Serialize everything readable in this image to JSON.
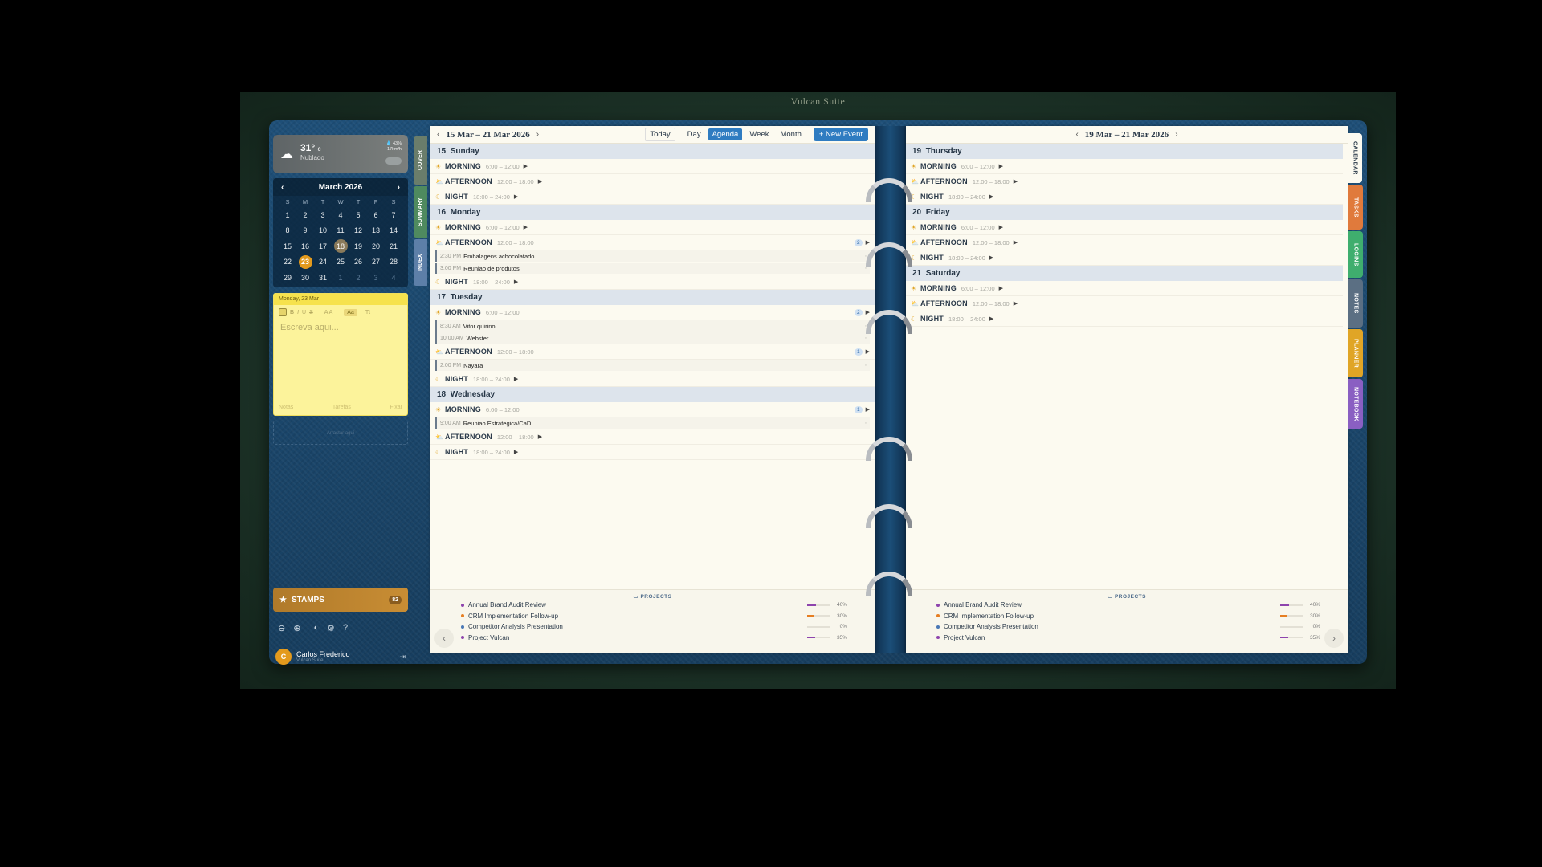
{
  "window": {
    "title": "Vulcan Suite"
  },
  "weather": {
    "temp": "31°",
    "unit": "c",
    "condition": "Nublado",
    "meta1": "💧 43%",
    "meta2": "17km/h"
  },
  "mini_calendar": {
    "month": "March 2026",
    "dow": [
      "S",
      "M",
      "T",
      "W",
      "T",
      "F",
      "S"
    ],
    "days": [
      [
        "1",
        "2",
        "3",
        "4",
        "5",
        "6",
        "7"
      ],
      [
        "8",
        "9",
        "10",
        "11",
        "12",
        "13",
        "14"
      ],
      [
        "15",
        "16",
        "17",
        "18",
        "19",
        "20",
        "21"
      ],
      [
        "22",
        "23",
        "24",
        "25",
        "26",
        "27",
        "28"
      ],
      [
        "29",
        "30",
        "31",
        "1",
        "2",
        "3",
        "4"
      ]
    ],
    "today": "18",
    "selected": "23"
  },
  "sticky": {
    "date": "Monday, 23 Mar",
    "placeholder": "Escreva aqui...",
    "size_label": "Aa",
    "tab_notes": "Notas",
    "tab_tasks": "Tarefas",
    "tab_pin": "Fixar"
  },
  "drop_hint": "Arrastar aqui",
  "stamps": {
    "label": "STAMPS",
    "count": "82"
  },
  "user": {
    "initial": "C",
    "name": "Carlos Frederico",
    "subtitle": "Vulcan Suite"
  },
  "left_tabs": [
    "COVER",
    "SUMMARY",
    "INDEX"
  ],
  "right_tabs": [
    "CALENDAR",
    "TASKS",
    "LOGINS",
    "NOTES",
    "PLANNER",
    "NOTEBOOK"
  ],
  "toolbar": {
    "range_left": "15 Mar – 21 Mar 2026",
    "range_right": "19 Mar – 21 Mar 2026",
    "today": "Today",
    "day": "Day",
    "agenda": "Agenda",
    "week": "Week",
    "month": "Month",
    "new_event": "+ New Event"
  },
  "slots": {
    "morning": "MORNING",
    "afternoon": "AFTERNOON",
    "night": "NIGHT",
    "morning_time": "6:00 – 12:00",
    "afternoon_time": "12:00 – 18:00",
    "night_time": "18:00 – 24:00"
  },
  "left_days": [
    {
      "num": "15",
      "name": "Sunday",
      "morning": {},
      "afternoon": {},
      "night": {}
    },
    {
      "num": "16",
      "name": "Monday",
      "afternoon": {
        "count": "2",
        "events": [
          {
            "time": "2:30",
            "ampm": "PM",
            "title": "Embalagens achocolatado"
          },
          {
            "time": "3:00",
            "ampm": "PM",
            "title": "Reuniao de produtos"
          }
        ]
      }
    },
    {
      "num": "17",
      "name": "Tuesday",
      "morning": {
        "count": "2",
        "events": [
          {
            "time": "8:30",
            "ampm": "AM",
            "title": "Vitor quirino"
          },
          {
            "time": "10:00",
            "ampm": "AM",
            "title": "Webster"
          }
        ]
      },
      "afternoon": {
        "count": "1",
        "events": [
          {
            "time": "2:00",
            "ampm": "PM",
            "title": "Nayara"
          }
        ]
      }
    },
    {
      "num": "18",
      "name": "Wednesday",
      "morning": {
        "count": "1",
        "events": [
          {
            "time": "9:00",
            "ampm": "AM",
            "title": "Reuniao Estrategica/CaD"
          }
        ]
      }
    }
  ],
  "right_days": [
    {
      "num": "19",
      "name": "Thursday"
    },
    {
      "num": "20",
      "name": "Friday"
    },
    {
      "num": "21",
      "name": "Saturday"
    }
  ],
  "projects": {
    "header": "PROJECTS",
    "items": [
      {
        "name": "Annual Brand Audit Review",
        "pct": "40%",
        "value": 40,
        "color": "#8e44ad"
      },
      {
        "name": "CRM Implementation Follow-up",
        "pct": "30%",
        "value": 30,
        "color": "#e67e22"
      },
      {
        "name": "Competitor Analysis Presentation",
        "pct": "0%",
        "value": 0,
        "color": "#4a78b5"
      },
      {
        "name": "Project Vulcan",
        "pct": "35%",
        "value": 35,
        "color": "#8e44ad"
      }
    ]
  },
  "colors": {
    "accent": "#2f7cc1",
    "stamps": "#c88d34",
    "sticky": "#fcf39b"
  }
}
